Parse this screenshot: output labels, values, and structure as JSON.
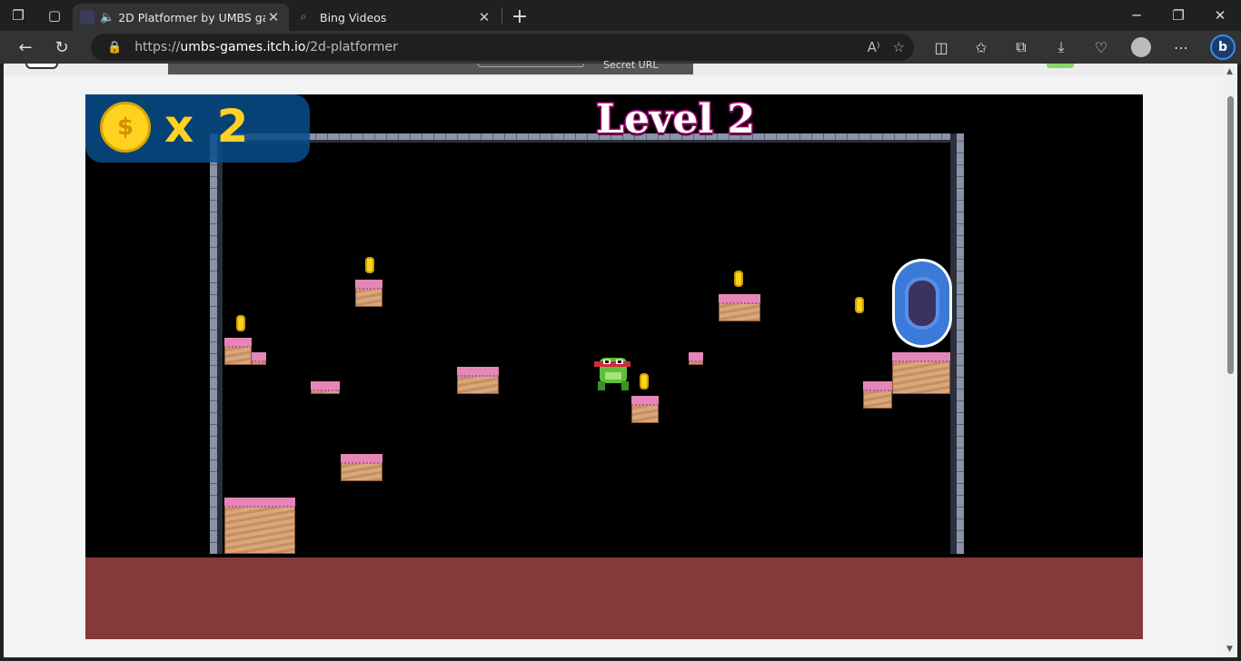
{
  "browser": {
    "tabs": [
      {
        "title": "2D Platformer by UMBS games",
        "active": true,
        "audio": true
      },
      {
        "title": "Bing Videos",
        "active": false
      }
    ],
    "url": {
      "scheme": "https://",
      "host": "umbs-games.itch.io",
      "path": "/2d-platformer"
    }
  },
  "page": {
    "secret_url_label": "Secret URL"
  },
  "game": {
    "coin_count": "x 2",
    "level_title": "Level 2",
    "hud_coin_glyph": "$"
  },
  "colors": {
    "floor": "#843a3a",
    "hud": "#084e8c",
    "coin": "#ffd21f",
    "platform_top": "#e486b8",
    "portal": "#3a7ad8"
  }
}
